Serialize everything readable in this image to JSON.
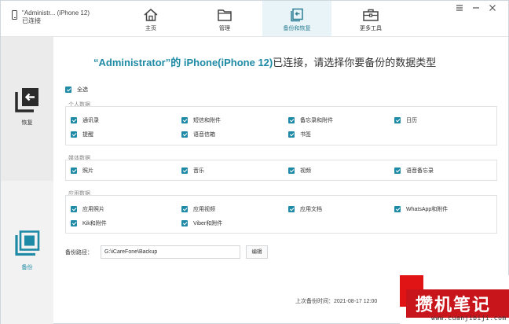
{
  "device": {
    "name": "\"Administr... (iPhone 12)",
    "status": "已连接"
  },
  "tabs": [
    {
      "label": "主页",
      "icon": "home-icon"
    },
    {
      "label": "管理",
      "icon": "folder-icon"
    },
    {
      "label": "备份和恢复",
      "icon": "backup-restore-icon",
      "active": true
    },
    {
      "label": "更多工具",
      "icon": "toolbox-icon"
    }
  ],
  "sidebar": {
    "restore_label": "恢复",
    "backup_label": "备份"
  },
  "heading": {
    "device": "“Administrator”的 iPhone(iPhone 12)",
    "suffix": "已连接，请选择你要备份的数据类型"
  },
  "select_all": "全选",
  "groups": [
    {
      "title": "个人数据",
      "items": [
        "通讯录",
        "短信和附件",
        "备忘录和附件",
        "日历",
        "提醒",
        "语音信箱",
        "书签"
      ]
    },
    {
      "title": "媒体数据",
      "items": [
        "照片",
        "音乐",
        "视频",
        "语音备忘录"
      ]
    },
    {
      "title": "应用数据",
      "items": [
        "应用照片",
        "应用视频",
        "应用文档",
        "WhatsApp和附件",
        "Kik和附件",
        "Viber和附件"
      ]
    }
  ],
  "backup_path": {
    "label": "备份路径：",
    "value": "G:\\iCareFone\\Backup",
    "edit_label": "编辑"
  },
  "last_backup": "上次备份时间：2021-08-17 12:00",
  "watermark": {
    "title": "攒机笔记",
    "url": "www.cuanjibiji.com"
  },
  "colors": {
    "accent": "#1e8aa5",
    "active_tab_bg": "#e8f4f7",
    "watermark_red": "#c8151b"
  }
}
